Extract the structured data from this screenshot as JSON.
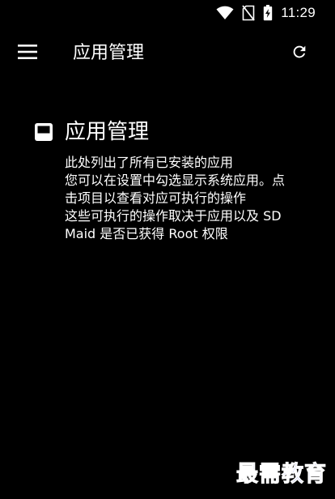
{
  "status_bar": {
    "time": "11:29",
    "icons": [
      "wifi-icon",
      "no-sim-icon",
      "battery-charging-icon"
    ]
  },
  "toolbar": {
    "menu_icon": "hamburger-menu-icon",
    "title": "应用管理",
    "refresh_icon": "refresh-icon"
  },
  "empty_state": {
    "icon": "app-box-icon",
    "title": "应用管理",
    "description": "此处列出了所有已安装的应用\n您可以在设置中勾选显示系统应用。点击项目以查看对应可执行的操作\n这些可执行的操作取决于应用以及 SD Maid 是否已获得 Root 权限"
  },
  "watermark": {
    "text": "最需教育"
  },
  "colors": {
    "background": "#000000",
    "foreground": "#ffffff",
    "watermark": "#2b3fd6"
  }
}
